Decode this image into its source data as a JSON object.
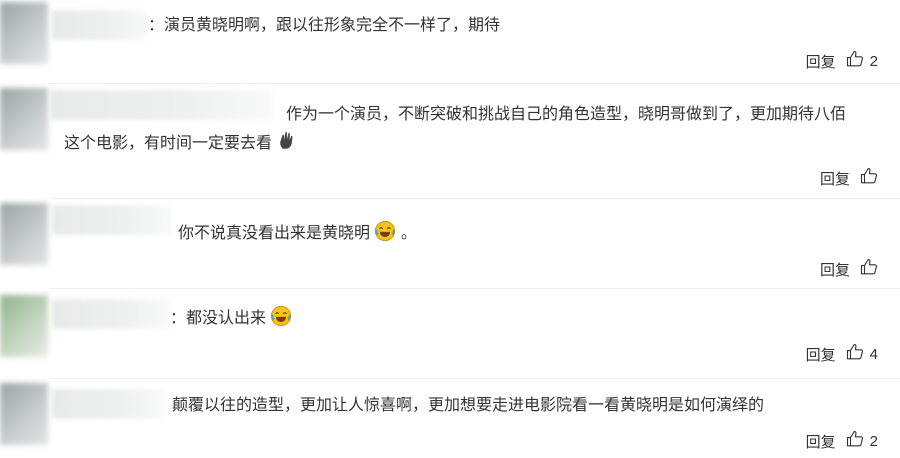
{
  "comments": [
    {
      "text": "：演员黄晓明啊，跟以往形象完全不一样了，期待",
      "reply_label": "回复",
      "like_count": "2"
    },
    {
      "text_line1": "作为一个演员，不断突破和挑战自己的角色造型，晓明哥做到了，更加期待八佰",
      "text_line2": "这个电影，有时间一定要去看",
      "reply_label": "回复",
      "like_count": ""
    },
    {
      "text": "你不说真没看出来是黄晓明",
      "trail": "。",
      "reply_label": "回复",
      "like_count": ""
    },
    {
      "text": "：都没认出来",
      "reply_label": "回复",
      "like_count": "4"
    },
    {
      "text": "颠覆以往的造型，更加让人惊喜啊，更加想要走进电影院看一看黄晓明是如何演绎的",
      "reply_label": "回复",
      "like_count": "2"
    }
  ],
  "icons": {
    "like": "thumbs-up-icon",
    "emoji_laugh": "laughing-tears-emoji-icon",
    "emoji_hand": "waving-hand-emoji-icon"
  },
  "colors": {
    "text": "#333333",
    "divider": "#eeeeee",
    "emoji_yellow": "#f6c21c"
  }
}
